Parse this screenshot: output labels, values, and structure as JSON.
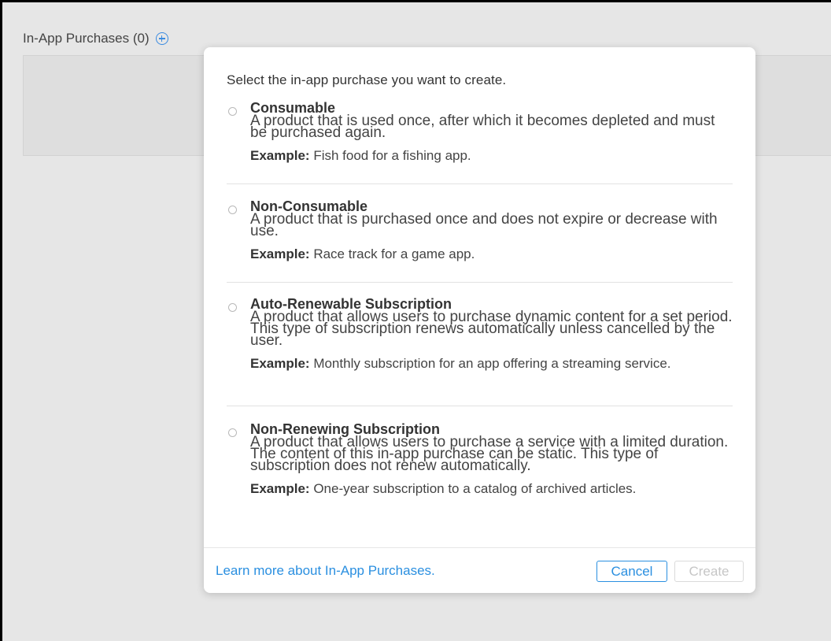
{
  "page": {
    "section_title": "In-App Purchases (0)"
  },
  "modal": {
    "title": "Select the in-app purchase you want to create.",
    "options": [
      {
        "name": "Consumable",
        "description": "A product that is used once, after which it becomes depleted and must be purchased again.",
        "example_label": "Example:",
        "example_text": " Fish food for a fishing app."
      },
      {
        "name": "Non-Consumable",
        "description": "A product that is purchased once and does not expire or decrease with use.",
        "example_label": "Example:",
        "example_text": " Race track for a game app."
      },
      {
        "name": "Auto-Renewable Subscription",
        "description": "A product that allows users to purchase dynamic content for a set period. This type of subscription renews automatically unless cancelled by the user.",
        "example_label": "Example:",
        "example_text": " Monthly subscription for an app offering a streaming service."
      },
      {
        "name": "Non-Renewing Subscription",
        "description": "A product that allows users to purchase a service with a limited duration. The content of this in-app purchase can be static. This type of subscription does not renew automatically.",
        "example_label": "Example:",
        "example_text": " One-year subscription to a catalog of archived articles."
      }
    ],
    "footer": {
      "learn_more": "Learn more about In-App Purchases.",
      "cancel": "Cancel",
      "create": "Create"
    }
  },
  "colors": {
    "accent": "#2a8fe0",
    "background": "#e6e6e6",
    "disabled": "#c6c6c6"
  },
  "icons": {
    "add": "add-circle-icon",
    "radio": "radio-unselected-icon"
  }
}
